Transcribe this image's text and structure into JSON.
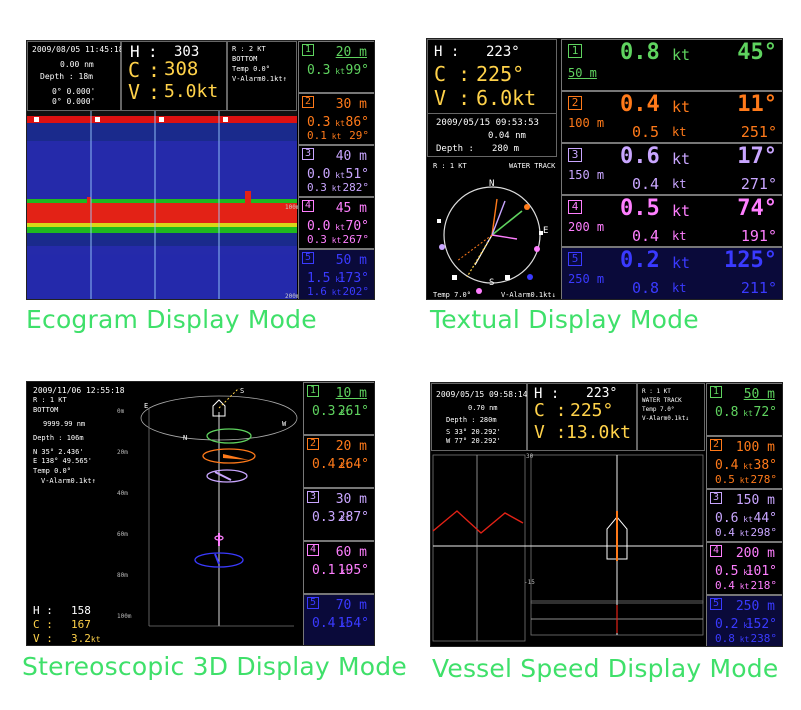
{
  "captions": {
    "ecogram": "Ecogram Display Mode",
    "textual": "Textual Display Mode",
    "stereo": "Stereoscopic 3D Display Mode",
    "vessel": "Vessel Speed Display Mode"
  },
  "colors": {
    "layer1": "#5fd35f",
    "layer2": "#ff7a1a",
    "layer3": "#c9a6ff",
    "layer4": "#ff7fff",
    "layer5": "#3a3aff",
    "caption": "#3fe06a"
  },
  "ecogram": {
    "datetime": "2009/08/05 11:45:18",
    "dist": "0.00 nm",
    "depth_label": "Depth : 18m",
    "lat": "0° 0.000'",
    "lon": "0° 0.000'",
    "H_label": "H",
    "C_label": "C",
    "V_label": "V",
    "heading": "303",
    "course": "308",
    "speed": "5.0kt",
    "r_line": "R : 2 KT",
    "bottom": "BOTTOM",
    "temp": "Temp 0.0°",
    "alarm": "V-Alarm0.1kt↑",
    "scale_mid": "100m",
    "scale_bot": "200m",
    "layers": [
      {
        "num": "1",
        "depth": "20 m",
        "s1": "0.3",
        "a1": "99°",
        "s2": "",
        "a2": ""
      },
      {
        "num": "2",
        "depth": "30 m",
        "s1": "0.3",
        "a1": "86°",
        "s2": "0.1",
        "a2": "29°"
      },
      {
        "num": "3",
        "depth": "40 m",
        "s1": "0.0",
        "a1": "51°",
        "s2": "0.3",
        "a2": "282°"
      },
      {
        "num": "4",
        "depth": "45 m",
        "s1": "0.0",
        "a1": "70°",
        "s2": "0.3",
        "a2": "267°"
      },
      {
        "num": "5",
        "depth": "50 m",
        "s1": "1.5",
        "a1": "173°",
        "s2": "1.6",
        "a2": "202°"
      }
    ]
  },
  "textual": {
    "H_label": "H :",
    "C_label": "C :",
    "V_label": "V :",
    "heading": "223°",
    "course": "225°",
    "speed": "6.0kt",
    "datetime": "2009/05/15 09:53:53",
    "dist": "0.04 nm",
    "depth_label": "Depth :",
    "depth_value": "280 m",
    "r_line": "R : 1 KT",
    "mode": "WATER TRACK",
    "compass": {
      "N": "N",
      "E": "E",
      "S": "S"
    },
    "temp": "Temp  7.0°",
    "alarm": "V-Alarm0.1kt↓",
    "kt": "kt",
    "layers": [
      {
        "num": "1",
        "depth": "50 m",
        "s1": "0.8",
        "a1": "45°",
        "s2": "",
        "a2": ""
      },
      {
        "num": "2",
        "depth": "100 m",
        "s1": "0.4",
        "a1": "11°",
        "s2": "0.5",
        "a2": "251°"
      },
      {
        "num": "3",
        "depth": "150 m",
        "s1": "0.6",
        "a1": "17°",
        "s2": "0.4",
        "a2": "271°"
      },
      {
        "num": "4",
        "depth": "200 m",
        "s1": "0.5",
        "a1": "74°",
        "s2": "0.4",
        "a2": "191°"
      },
      {
        "num": "5",
        "depth": "250 m",
        "s1": "0.2",
        "a1": "125°",
        "s2": "0.8",
        "a2": "211°"
      }
    ]
  },
  "stereo": {
    "datetime": "2009/11/06 12:55:18",
    "r_line": "R : 1 KT",
    "bottom": "BOTTOM",
    "dist": "9999.99 nm",
    "depth_label": "Depth : 106m",
    "lat": "N  35° 2.436'",
    "lon": "E 138° 49.565'",
    "temp": "Temp  0.0°",
    "alarm": "V-Alarm0.1kt↑",
    "H_label": "H :",
    "C_label": "C :",
    "V_label": "V :",
    "heading": "158",
    "course": "167",
    "speed": "3.2",
    "speed_unit": "kt",
    "axis": [
      "0m",
      "20m",
      "40m",
      "60m",
      "80m",
      "100m"
    ],
    "compass": {
      "N": "N",
      "E": "E",
      "S": "S",
      "W": "W"
    },
    "layers": [
      {
        "num": "1",
        "depth": "10 m",
        "s1": "0.3",
        "a1": "261°"
      },
      {
        "num": "2",
        "depth": "20 m",
        "s1": "0.4",
        "a1": "264°"
      },
      {
        "num": "3",
        "depth": "30 m",
        "s1": "0.3",
        "a1": "287°"
      },
      {
        "num": "4",
        "depth": "60 m",
        "s1": "0.1",
        "a1": "195°"
      },
      {
        "num": "5",
        "depth": "70 m",
        "s1": "0.4",
        "a1": "154°"
      }
    ]
  },
  "vessel": {
    "datetime": "2009/05/15 09:58:14",
    "dist": "0.70 nm",
    "depth_label": "Depth : 280m",
    "lat": "S  33° 20.292'",
    "lon": "W  77° 20.292'",
    "H_label": "H :",
    "C_label": "C :",
    "V_label": "V :",
    "heading": "223°",
    "course": "225°",
    "speed": "13.0kt",
    "r_line": "R : 1 KT",
    "mode": "WATER TRACK",
    "temp": "Temp  7.0°",
    "alarm": "V-Alarm0.1kt↓",
    "graph_top": "30",
    "graph_bot": "-15",
    "layers": [
      {
        "num": "1",
        "depth": "50 m",
        "s1": "0.8",
        "a1": "72°",
        "s2": "",
        "a2": ""
      },
      {
        "num": "2",
        "depth": "100 m",
        "s1": "0.4",
        "a1": "38°",
        "s2": "0.5",
        "a2": "278°"
      },
      {
        "num": "3",
        "depth": "150 m",
        "s1": "0.6",
        "a1": "44°",
        "s2": "0.4",
        "a2": "298°"
      },
      {
        "num": "4",
        "depth": "200 m",
        "s1": "0.5",
        "a1": "101°",
        "s2": "0.4",
        "a2": "218°"
      },
      {
        "num": "5",
        "depth": "250 m",
        "s1": "0.2",
        "a1": "152°",
        "s2": "0.8",
        "a2": "238°"
      }
    ]
  }
}
